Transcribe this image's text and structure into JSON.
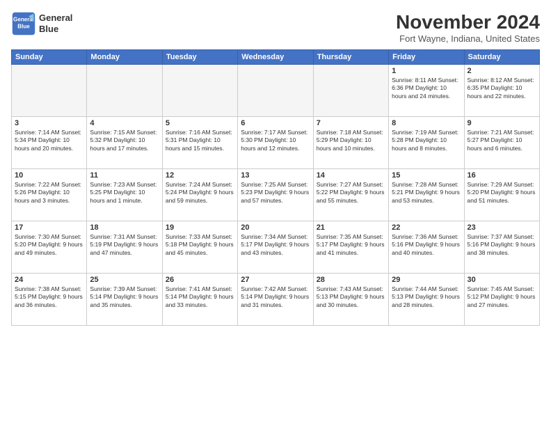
{
  "header": {
    "logo_line1": "General",
    "logo_line2": "Blue",
    "month": "November 2024",
    "location": "Fort Wayne, Indiana, United States"
  },
  "weekdays": [
    "Sunday",
    "Monday",
    "Tuesday",
    "Wednesday",
    "Thursday",
    "Friday",
    "Saturday"
  ],
  "weeks": [
    [
      {
        "day": "",
        "info": ""
      },
      {
        "day": "",
        "info": ""
      },
      {
        "day": "",
        "info": ""
      },
      {
        "day": "",
        "info": ""
      },
      {
        "day": "",
        "info": ""
      },
      {
        "day": "1",
        "info": "Sunrise: 8:11 AM\nSunset: 6:36 PM\nDaylight: 10 hours\nand 24 minutes."
      },
      {
        "day": "2",
        "info": "Sunrise: 8:12 AM\nSunset: 6:35 PM\nDaylight: 10 hours\nand 22 minutes."
      }
    ],
    [
      {
        "day": "3",
        "info": "Sunrise: 7:14 AM\nSunset: 5:34 PM\nDaylight: 10 hours\nand 20 minutes."
      },
      {
        "day": "4",
        "info": "Sunrise: 7:15 AM\nSunset: 5:32 PM\nDaylight: 10 hours\nand 17 minutes."
      },
      {
        "day": "5",
        "info": "Sunrise: 7:16 AM\nSunset: 5:31 PM\nDaylight: 10 hours\nand 15 minutes."
      },
      {
        "day": "6",
        "info": "Sunrise: 7:17 AM\nSunset: 5:30 PM\nDaylight: 10 hours\nand 12 minutes."
      },
      {
        "day": "7",
        "info": "Sunrise: 7:18 AM\nSunset: 5:29 PM\nDaylight: 10 hours\nand 10 minutes."
      },
      {
        "day": "8",
        "info": "Sunrise: 7:19 AM\nSunset: 5:28 PM\nDaylight: 10 hours\nand 8 minutes."
      },
      {
        "day": "9",
        "info": "Sunrise: 7:21 AM\nSunset: 5:27 PM\nDaylight: 10 hours\nand 6 minutes."
      }
    ],
    [
      {
        "day": "10",
        "info": "Sunrise: 7:22 AM\nSunset: 5:26 PM\nDaylight: 10 hours\nand 3 minutes."
      },
      {
        "day": "11",
        "info": "Sunrise: 7:23 AM\nSunset: 5:25 PM\nDaylight: 10 hours\nand 1 minute."
      },
      {
        "day": "12",
        "info": "Sunrise: 7:24 AM\nSunset: 5:24 PM\nDaylight: 9 hours\nand 59 minutes."
      },
      {
        "day": "13",
        "info": "Sunrise: 7:25 AM\nSunset: 5:23 PM\nDaylight: 9 hours\nand 57 minutes."
      },
      {
        "day": "14",
        "info": "Sunrise: 7:27 AM\nSunset: 5:22 PM\nDaylight: 9 hours\nand 55 minutes."
      },
      {
        "day": "15",
        "info": "Sunrise: 7:28 AM\nSunset: 5:21 PM\nDaylight: 9 hours\nand 53 minutes."
      },
      {
        "day": "16",
        "info": "Sunrise: 7:29 AM\nSunset: 5:20 PM\nDaylight: 9 hours\nand 51 minutes."
      }
    ],
    [
      {
        "day": "17",
        "info": "Sunrise: 7:30 AM\nSunset: 5:20 PM\nDaylight: 9 hours\nand 49 minutes."
      },
      {
        "day": "18",
        "info": "Sunrise: 7:31 AM\nSunset: 5:19 PM\nDaylight: 9 hours\nand 47 minutes."
      },
      {
        "day": "19",
        "info": "Sunrise: 7:33 AM\nSunset: 5:18 PM\nDaylight: 9 hours\nand 45 minutes."
      },
      {
        "day": "20",
        "info": "Sunrise: 7:34 AM\nSunset: 5:17 PM\nDaylight: 9 hours\nand 43 minutes."
      },
      {
        "day": "21",
        "info": "Sunrise: 7:35 AM\nSunset: 5:17 PM\nDaylight: 9 hours\nand 41 minutes."
      },
      {
        "day": "22",
        "info": "Sunrise: 7:36 AM\nSunset: 5:16 PM\nDaylight: 9 hours\nand 40 minutes."
      },
      {
        "day": "23",
        "info": "Sunrise: 7:37 AM\nSunset: 5:16 PM\nDaylight: 9 hours\nand 38 minutes."
      }
    ],
    [
      {
        "day": "24",
        "info": "Sunrise: 7:38 AM\nSunset: 5:15 PM\nDaylight: 9 hours\nand 36 minutes."
      },
      {
        "day": "25",
        "info": "Sunrise: 7:39 AM\nSunset: 5:14 PM\nDaylight: 9 hours\nand 35 minutes."
      },
      {
        "day": "26",
        "info": "Sunrise: 7:41 AM\nSunset: 5:14 PM\nDaylight: 9 hours\nand 33 minutes."
      },
      {
        "day": "27",
        "info": "Sunrise: 7:42 AM\nSunset: 5:14 PM\nDaylight: 9 hours\nand 31 minutes."
      },
      {
        "day": "28",
        "info": "Sunrise: 7:43 AM\nSunset: 5:13 PM\nDaylight: 9 hours\nand 30 minutes."
      },
      {
        "day": "29",
        "info": "Sunrise: 7:44 AM\nSunset: 5:13 PM\nDaylight: 9 hours\nand 28 minutes."
      },
      {
        "day": "30",
        "info": "Sunrise: 7:45 AM\nSunset: 5:12 PM\nDaylight: 9 hours\nand 27 minutes."
      }
    ]
  ]
}
